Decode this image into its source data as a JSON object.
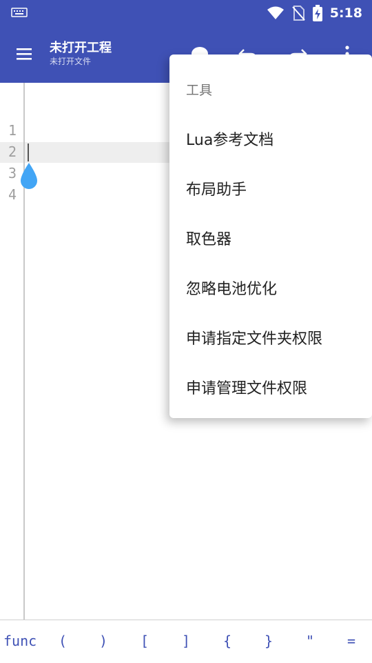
{
  "status_bar": {
    "time": "5:18",
    "icons": [
      "keyboard-icon",
      "wifi-icon",
      "no-sim-icon",
      "battery-charging-icon"
    ]
  },
  "toolbar": {
    "title": "未打开工程",
    "subtitle": "未打开文件",
    "icons": [
      "menu-icon",
      "run-icon",
      "undo-icon",
      "redo-icon",
      "more-vert-icon"
    ]
  },
  "editor": {
    "line_numbers": [
      "1",
      "2",
      "3",
      "4"
    ]
  },
  "popup_menu": {
    "header": "工具",
    "items": [
      "Lua参考文档",
      "布局助手",
      "取色器",
      "忽略电池优化",
      "申请指定文件夹权限",
      "申请管理文件权限"
    ]
  },
  "symbol_bar": {
    "symbols": [
      "func",
      "(",
      ")",
      "[",
      "]",
      "{",
      "}",
      "\"",
      "="
    ]
  },
  "colors": {
    "primary": "#3f51b5",
    "accent": "#42a5f5"
  }
}
